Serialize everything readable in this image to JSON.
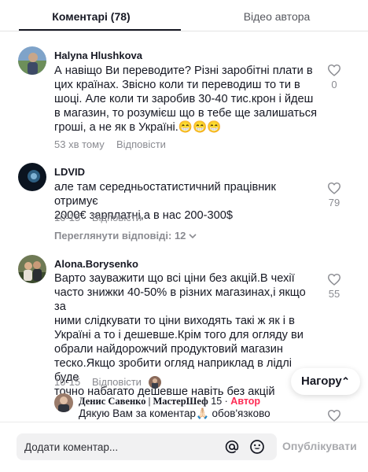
{
  "tabs": {
    "comments_label": "Коментарі (78)",
    "author_videos_label": "Відео автора"
  },
  "comments": [
    {
      "username": "Halyna Hlushkova",
      "text": "А навіщо Ви переводите? Різні заробітні плати в\nцих країнах. Звісно коли ти переводиш то ти в\nшоці. Але коли ти заробив 30-40 тис.крон і йдеш\nв магазин, то розумієш що в тебе ще залишаться\nгроші, а не як в Україні.😁😁😁",
      "time": "53 хв тому",
      "reply_label": "Відповісти",
      "likes": "0"
    },
    {
      "username": "LDVID",
      "text": "але там середньостатистичний працівник отримує\n2000€ зарплатні,а в нас 200-300$",
      "time": "10-15",
      "reply_label": "Відповісти",
      "likes": "79",
      "view_replies_label": "Переглянути відповіді: 12"
    },
    {
      "username": "Alona.Borysenko",
      "text": "Варто зауважити що всі ціни без акцій.В чехії\nчасто знижки 40-50% в різних магазинах,і якщо за\nними слідкувати то ціни виходять такі ж як і в\nУкраїні а то і дешевше.Крім того для огляду ви\nобрали найдорожчий продуктовий магазин\nтеско.Якщо зробити огляд наприклад в лідлі буде\nточно набагато дешевше навіть без акцій",
      "time": "10-15",
      "reply_label": "Відповісти",
      "likes": "55"
    }
  ],
  "author_reply": {
    "name": "Денис Савенко | МастерШеф",
    "count": "15",
    "separator": "·",
    "badge": "Автор",
    "text": "Дякую Вам за коментар🙏🏻 обов'язково"
  },
  "top_button_label": "Нагору",
  "comment_input": {
    "placeholder": "Додати коментар...",
    "publish_label": "Опублікувати"
  }
}
